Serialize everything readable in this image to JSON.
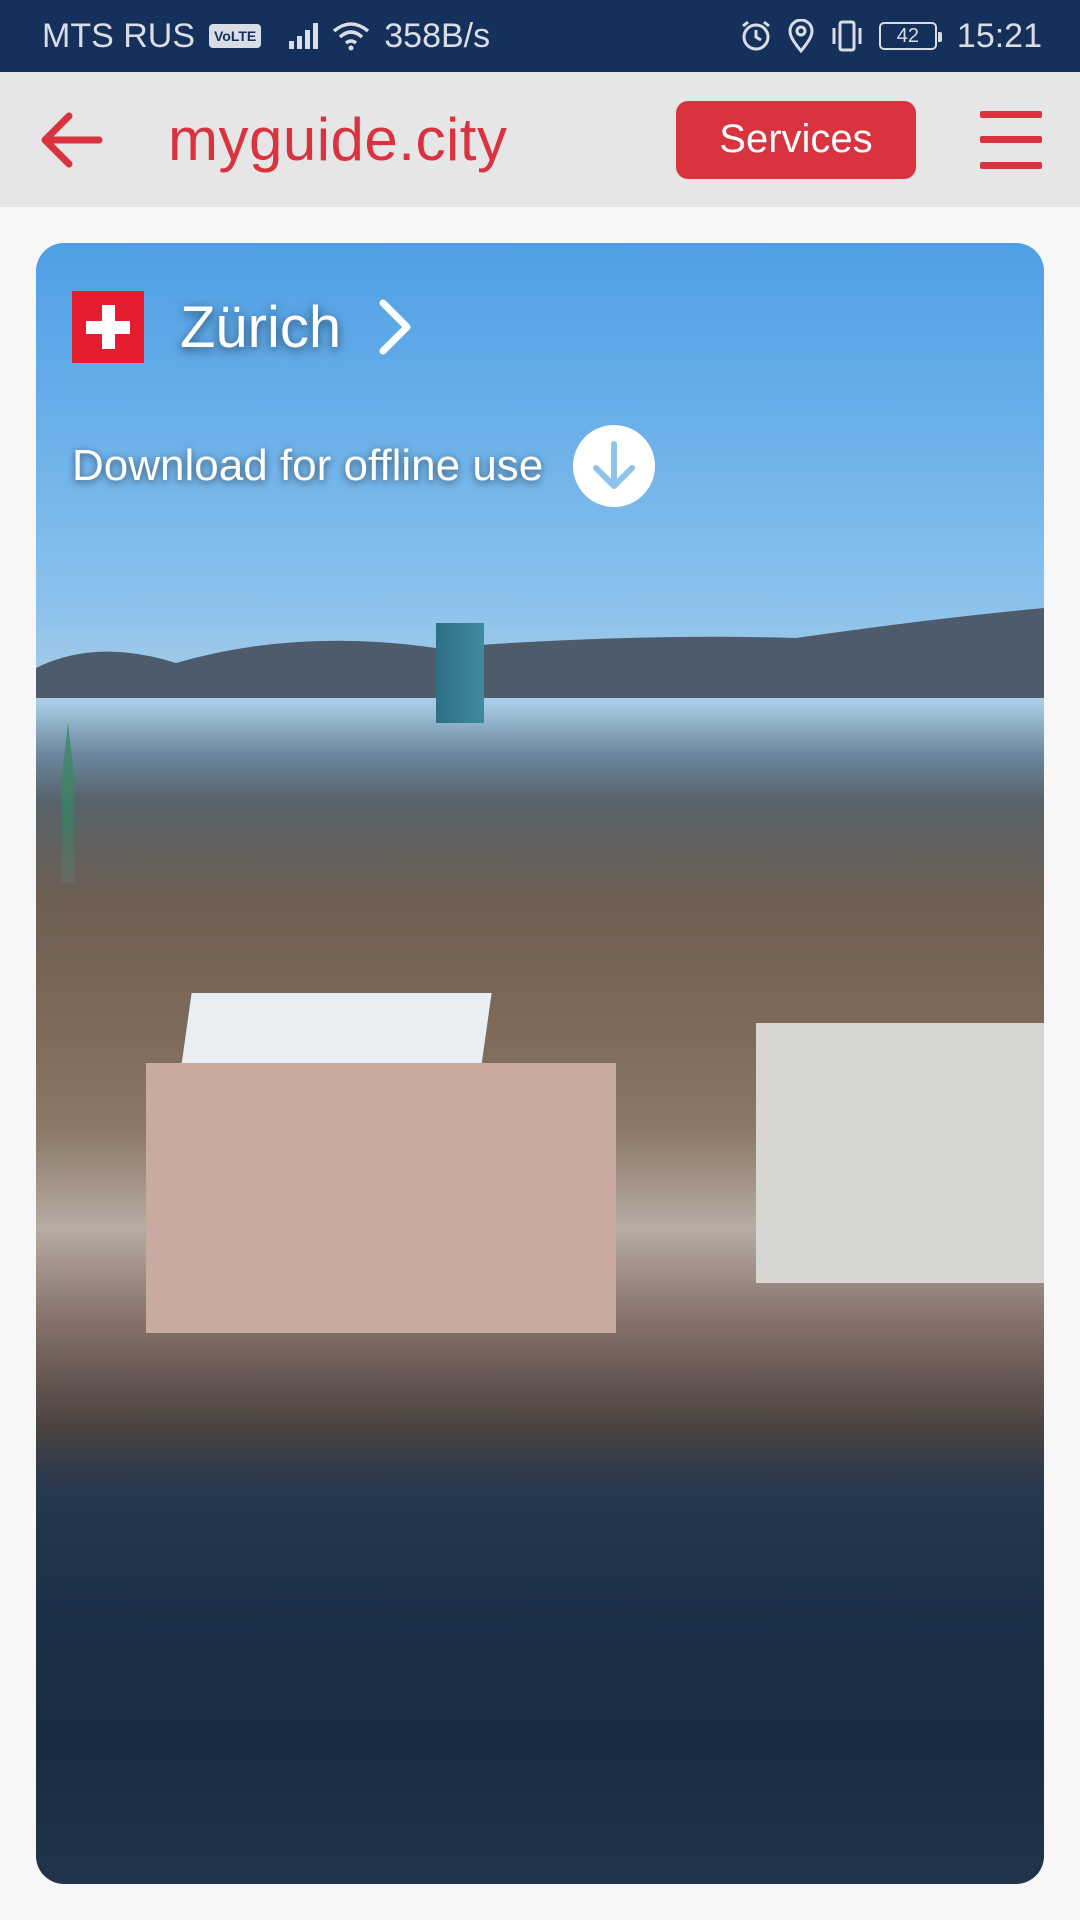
{
  "status_bar": {
    "carrier": "MTS RUS",
    "volte": "VoLTE",
    "network_speed": "358B/s",
    "battery": "42",
    "time": "15:21"
  },
  "toolbar": {
    "brand": "myguide.city",
    "services_label": "Services"
  },
  "city": {
    "name": "Zürich",
    "download_label": "Download for offline use"
  },
  "colors": {
    "accent": "#d93340",
    "status_bar": "#16305c",
    "toolbar_bg": "#e6e6e6"
  }
}
